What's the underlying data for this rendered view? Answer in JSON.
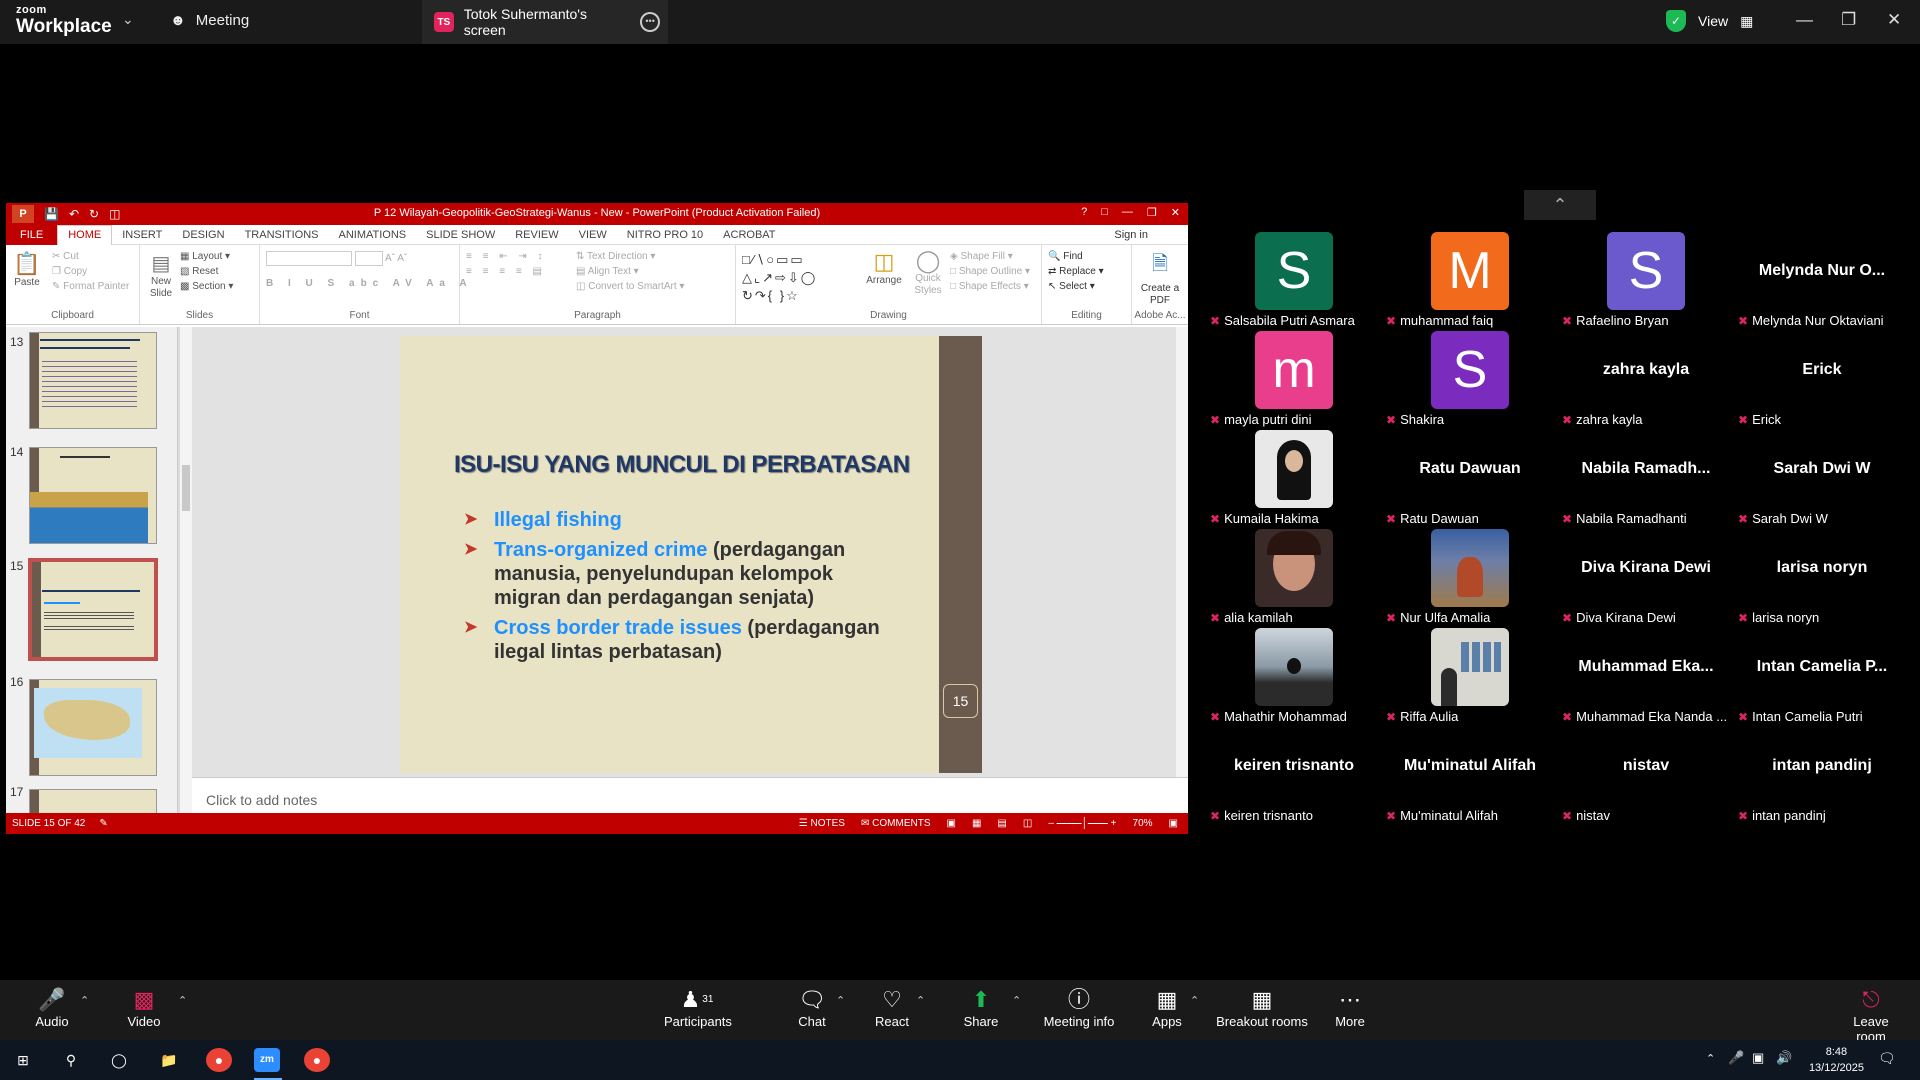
{
  "zoom": {
    "logo_top": "zoom",
    "logo_bottom": "Workplace",
    "meeting_label": "Meeting",
    "share_badge": "TS",
    "share_title": "Totok Suhermanto's screen",
    "view_label": "View"
  },
  "ppt": {
    "title": "P 12 Wilayah-Geopolitik-GeoStrategi-Wanus - New - PowerPoint (Product Activation Failed)",
    "tabs": [
      "FILE",
      "HOME",
      "INSERT",
      "DESIGN",
      "TRANSITIONS",
      "ANIMATIONS",
      "SLIDE SHOW",
      "REVIEW",
      "VIEW",
      "NITRO PRO 10",
      "ACROBAT"
    ],
    "sign_in": "Sign in",
    "groups": {
      "clipboard": {
        "label": "Clipboard",
        "paste": "Paste",
        "cut": "Cut",
        "copy": "Copy",
        "format_painter": "Format Painter"
      },
      "slides": {
        "label": "Slides",
        "new_slide": "New Slide",
        "layout": "Layout",
        "reset": "Reset",
        "section": "Section"
      },
      "font": {
        "label": "Font"
      },
      "paragraph": {
        "label": "Paragraph",
        "text_direction": "Text Direction",
        "align_text": "Align Text",
        "smartart": "Convert to SmartArt"
      },
      "drawing": {
        "label": "Drawing",
        "arrange": "Arrange",
        "quick_styles": "Quick Styles",
        "shape_fill": "Shape Fill",
        "shape_outline": "Shape Outline",
        "shape_effects": "Shape Effects"
      },
      "editing": {
        "label": "Editing",
        "find": "Find",
        "replace": "Replace",
        "select": "Select"
      },
      "adobe": {
        "label": "Adobe Ac...",
        "create_pdf": "Create a PDF"
      }
    },
    "thumb_numbers": [
      "13",
      "14",
      "15",
      "16",
      "17"
    ],
    "slide": {
      "title": "ISU-ISU YANG MUNCUL DI PERBATASAN",
      "bullets": [
        {
          "highlight": "Illegal fishing",
          "rest": ""
        },
        {
          "highlight": "Trans-organized crime",
          "rest": " (perdagangan manusia, penyelundupan kelompok migran dan perdagangan senjata)"
        },
        {
          "highlight": "Cross border trade issues",
          "rest": " (perdagangan ilegal lintas perbatasan)"
        }
      ],
      "number": "15"
    },
    "notes_placeholder": "Click to add notes",
    "status": {
      "slide_of": "SLIDE 15 OF 42",
      "notes": "NOTES",
      "comments": "COMMENTS",
      "zoom": "70%"
    }
  },
  "participants": [
    {
      "name": "Salsabila Putri Asmara",
      "avatar": "S",
      "color": "#0b6e4f",
      "type": "letter"
    },
    {
      "name": "muhammad faiq",
      "avatar": "M",
      "color": "#f26b1d",
      "type": "letter"
    },
    {
      "name": "Rafaelino Bryan",
      "avatar": "S",
      "color": "#6a5acd",
      "type": "letter"
    },
    {
      "name": "Melynda Nur Oktaviani",
      "display": "Melynda Nur O...",
      "type": "name"
    },
    {
      "name": "mayla putri dini",
      "avatar": "m",
      "color": "#e83e8c",
      "type": "letter"
    },
    {
      "name": "Shakira",
      "avatar": "S",
      "color": "#7b2cbf",
      "type": "letter"
    },
    {
      "name": "zahra kayla",
      "display": "zahra kayla",
      "type": "name"
    },
    {
      "name": "Erick",
      "display": "Erick",
      "type": "name"
    },
    {
      "name": "Kumaila Hakima",
      "type": "photo",
      "photo": "hijab"
    },
    {
      "name": "Ratu Dawuan",
      "display": "Ratu Dawuan",
      "type": "name"
    },
    {
      "name": "Nabila Ramadhanti",
      "display": "Nabila  Ramadh...",
      "type": "name"
    },
    {
      "name": "Sarah Dwi W",
      "display": "Sarah Dwi W",
      "type": "name"
    },
    {
      "name": "alia kamilah",
      "type": "photo",
      "photo": "face"
    },
    {
      "name": "Nur Ulfa Amalia",
      "type": "photo",
      "photo": "room"
    },
    {
      "name": "Diva Kirana Dewi",
      "display": "Diva Kirana Dewi",
      "type": "name"
    },
    {
      "name": "larisa noryn",
      "display": "larisa noryn",
      "type": "name"
    },
    {
      "name": "Mahathir Mohammad",
      "type": "photo",
      "photo": "sunset"
    },
    {
      "name": "Riffa Aulia",
      "type": "photo",
      "photo": "gallery"
    },
    {
      "name": "Muhammad Eka Nanda ...",
      "display": "Muhammad  Eka...",
      "type": "name"
    },
    {
      "name": "Intan Camelia Putri",
      "display": "Intan Camelia P...",
      "type": "name"
    },
    {
      "name": "keiren trisnanto",
      "display": "keiren trisnanto",
      "type": "name"
    },
    {
      "name": "Mu'minatul Alifah",
      "display": "Mu'minatul Alifah",
      "type": "name"
    },
    {
      "name": "nistav",
      "display": "nistav",
      "type": "name"
    },
    {
      "name": "intan pandinj",
      "display": "intan pandinj",
      "type": "name"
    }
  ],
  "toolbar": {
    "audio": "Audio",
    "video": "Video",
    "participants": "Participants",
    "participants_count": "31",
    "chat": "Chat",
    "react": "React",
    "share": "Share",
    "meeting_info": "Meeting info",
    "apps": "Apps",
    "breakout": "Breakout rooms",
    "more": "More",
    "leave": "Leave room"
  },
  "taskbar": {
    "time": "8:48",
    "date": "13/12/2025"
  }
}
